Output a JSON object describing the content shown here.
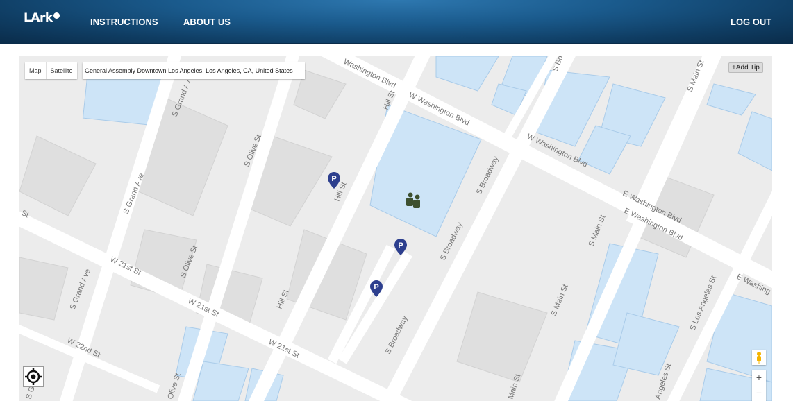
{
  "header": {
    "logo_text": "LArk",
    "nav": {
      "instructions": "INSTRUCTIONS",
      "about": "ABOUT US",
      "logout": "LOG OUT"
    }
  },
  "map": {
    "type_controls": {
      "map": "Map",
      "satellite": "Satellite"
    },
    "search": {
      "value": "General Assembly Downtown Los Angeles, Los Angeles, CA, United States"
    },
    "add_tip_label": "+Add Tip",
    "zoom": {
      "in": "+",
      "out": "−"
    },
    "street_labels": {
      "washington_top": "Washington Blvd",
      "w_washington_1": "W Washington Blvd",
      "w_washington_2": "W Washington Blvd",
      "e_washington_1": "E Washington Blvd",
      "e_washington_2": "E Washington Blvd",
      "e_washing": "E Washing",
      "w_21st_1": "W 21st St",
      "w_21st_2": "W 21st St",
      "w_21st_3": "W 21st St",
      "w_22nd": "W 22nd St",
      "st_left": "St",
      "s_grand_1": "S Grand Av",
      "s_grand_2": "S Grand Ave",
      "s_grand_3": "S Grand Ave",
      "s_olive_1": "S Olive St",
      "s_olive_2": "S Olive St",
      "s_olive_3": "S Olive St",
      "hill_1": "Hill St",
      "hill_2": "Hill St",
      "hill_3": "Hill St",
      "s_broadway_1": "S Broadway",
      "s_broadway_2": "S Broadway",
      "s_broadway_3": "S Broadway",
      "s_main_1": "S Main St",
      "s_main_2": "S Main St",
      "s_main_3": "S Main St",
      "s_la_1": "S Los Angeles St",
      "s_la_2": "Angeles St",
      "s_bo": "S Bo",
      "s_main_top": "S Main St",
      "main_st_bottom": "Main St",
      "olive_bottom": "Olive St",
      "ga_bottom": "S Grand"
    }
  },
  "colors": {
    "navbar": "#1a5a8c",
    "marker": "#2d3f8e",
    "building": "#cde4f7",
    "road": "#ffffff",
    "land": "#ececec"
  }
}
